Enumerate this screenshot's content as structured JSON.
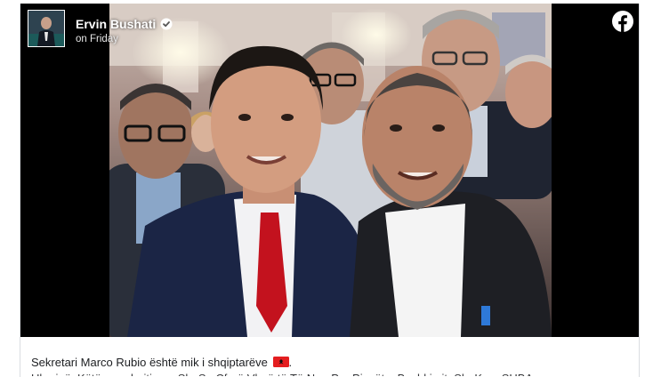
{
  "post": {
    "author_name": "Ervin Bushati",
    "timestamp": "on Friday",
    "caption_text": "Sekretari Marco Rubio është mik i shqiptarëve",
    "caption_suffix": ".",
    "caption_second_line": "Ukrainë, Këtë menderitjen e Sh. Se Çfarë Vlerë të Të Nga Per Pjesët e Bashkimit. Sh. Kon. SHBA"
  },
  "icons": {
    "verified": "verified-badge-icon",
    "platform": "facebook-logo-icon",
    "flag": "albania-flag-icon"
  },
  "colors": {
    "brand_text": "#1c1e21",
    "card_border": "#dadde1",
    "media_background": "#000000",
    "flag_red": "#e41e20"
  }
}
